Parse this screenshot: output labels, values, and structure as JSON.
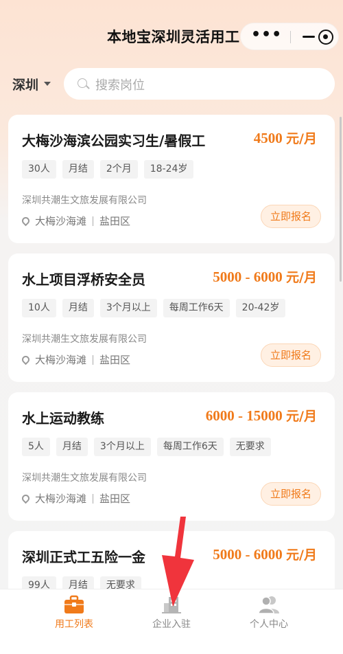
{
  "header": {
    "title": "本地宝深圳灵活用工",
    "capsule": {
      "more_icon": "more-dots-icon",
      "minimize_icon": "minus-icon",
      "close_icon": "target-icon"
    }
  },
  "search": {
    "city": "深圳",
    "placeholder": "搜索岗位"
  },
  "jobs": [
    {
      "title": "大梅沙海滨公园实习生/暑假工",
      "salary": "4500",
      "unit": "元/月",
      "tags": [
        "30人",
        "月结",
        "2个月",
        "18-24岁"
      ],
      "company": "深圳共潮生文旅发展有限公司",
      "location": "大梅沙海滩",
      "district": "盐田区",
      "apply_label": "立即报名"
    },
    {
      "title": "水上项目浮桥安全员",
      "salary": "5000 - 6000",
      "unit": "元/月",
      "tags": [
        "10人",
        "月结",
        "3个月以上",
        "每周工作6天",
        "20-42岁"
      ],
      "company": "深圳共潮生文旅发展有限公司",
      "location": "大梅沙海滩",
      "district": "盐田区",
      "apply_label": "立即报名"
    },
    {
      "title": "水上运动教练",
      "salary": "6000 - 15000",
      "unit": "元/月",
      "tags": [
        "5人",
        "月结",
        "3个月以上",
        "每周工作6天",
        "无要求"
      ],
      "company": "深圳共潮生文旅发展有限公司",
      "location": "大梅沙海滩",
      "district": "盐田区",
      "apply_label": "立即报名"
    },
    {
      "title": "深圳正式工五险一金",
      "salary": "5000 - 6000",
      "unit": "元/月",
      "tags": [
        "99人",
        "月结",
        "无要求"
      ],
      "company": "",
      "location": "",
      "district": "",
      "apply_label": ""
    }
  ],
  "tabbar": {
    "items": [
      {
        "label": "用工列表",
        "icon": "briefcase-icon",
        "active": true
      },
      {
        "label": "企业入驻",
        "icon": "building-icon",
        "active": false
      },
      {
        "label": "个人中心",
        "icon": "users-icon",
        "active": false
      }
    ]
  },
  "colors": {
    "accent": "#f07a1a",
    "accent_bg": "#fff0e3",
    "overlay_arrow": "#f0343c"
  }
}
